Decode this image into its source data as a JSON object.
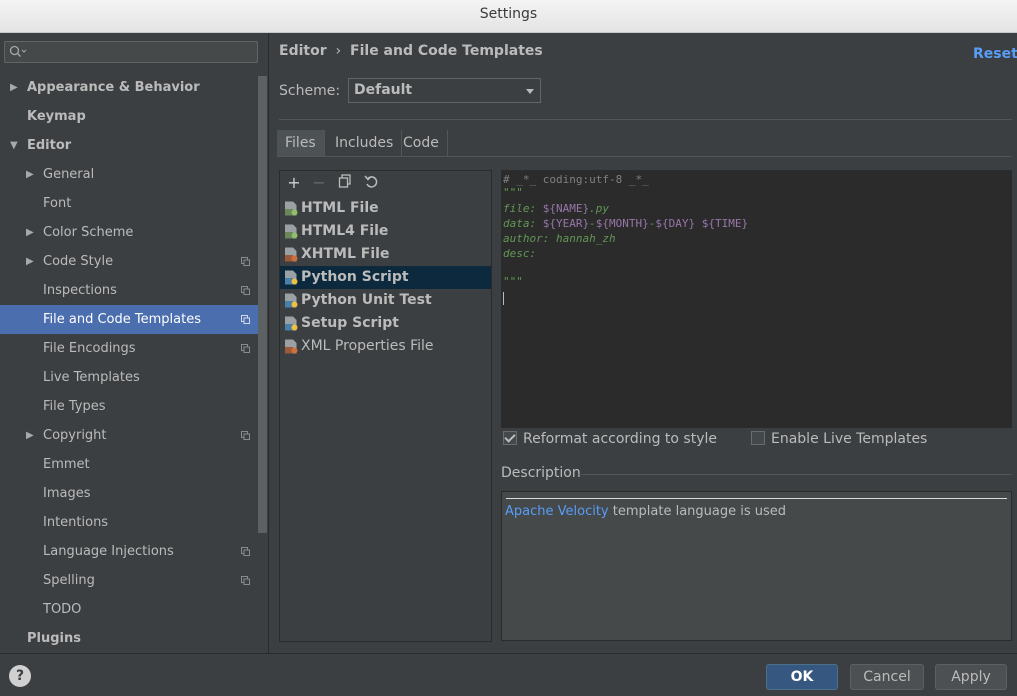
{
  "window": {
    "title": "Settings"
  },
  "sidebar": {
    "search_placeholder": "",
    "items": [
      {
        "label": "Appearance & Behavior",
        "level": 0,
        "arrow": "collapsed",
        "bold": true,
        "project": false,
        "selected": false
      },
      {
        "label": "Keymap",
        "level": 0,
        "arrow": "none",
        "bold": true,
        "project": false,
        "selected": false
      },
      {
        "label": "Editor",
        "level": 0,
        "arrow": "expanded",
        "bold": true,
        "project": false,
        "selected": false
      },
      {
        "label": "General",
        "level": 1,
        "arrow": "collapsed",
        "bold": false,
        "project": false,
        "selected": false
      },
      {
        "label": "Font",
        "level": 1,
        "arrow": "none",
        "bold": false,
        "project": false,
        "selected": false
      },
      {
        "label": "Color Scheme",
        "level": 1,
        "arrow": "collapsed",
        "bold": false,
        "project": false,
        "selected": false
      },
      {
        "label": "Code Style",
        "level": 1,
        "arrow": "collapsed",
        "bold": false,
        "project": true,
        "selected": false
      },
      {
        "label": "Inspections",
        "level": 1,
        "arrow": "none",
        "bold": false,
        "project": true,
        "selected": false
      },
      {
        "label": "File and Code Templates",
        "level": 1,
        "arrow": "none",
        "bold": false,
        "project": true,
        "selected": true
      },
      {
        "label": "File Encodings",
        "level": 1,
        "arrow": "none",
        "bold": false,
        "project": true,
        "selected": false
      },
      {
        "label": "Live Templates",
        "level": 1,
        "arrow": "none",
        "bold": false,
        "project": false,
        "selected": false
      },
      {
        "label": "File Types",
        "level": 1,
        "arrow": "none",
        "bold": false,
        "project": false,
        "selected": false
      },
      {
        "label": "Copyright",
        "level": 1,
        "arrow": "collapsed",
        "bold": false,
        "project": true,
        "selected": false
      },
      {
        "label": "Emmet",
        "level": 1,
        "arrow": "none",
        "bold": false,
        "project": false,
        "selected": false
      },
      {
        "label": "Images",
        "level": 1,
        "arrow": "none",
        "bold": false,
        "project": false,
        "selected": false
      },
      {
        "label": "Intentions",
        "level": 1,
        "arrow": "none",
        "bold": false,
        "project": false,
        "selected": false
      },
      {
        "label": "Language Injections",
        "level": 1,
        "arrow": "none",
        "bold": false,
        "project": true,
        "selected": false
      },
      {
        "label": "Spelling",
        "level": 1,
        "arrow": "none",
        "bold": false,
        "project": true,
        "selected": false
      },
      {
        "label": "TODO",
        "level": 1,
        "arrow": "none",
        "bold": false,
        "project": false,
        "selected": false
      },
      {
        "label": "Plugins",
        "level": 0,
        "arrow": "none",
        "bold": true,
        "project": false,
        "selected": false
      }
    ]
  },
  "breadcrumb": {
    "parent": "Editor",
    "separator": "›",
    "current": "File and Code Templates"
  },
  "reset_label": "Reset",
  "scheme": {
    "label": "Scheme:",
    "value": "Default"
  },
  "tabs": [
    {
      "label": "Files",
      "active": true
    },
    {
      "label": "Includes",
      "active": false
    },
    {
      "label": "Code",
      "active": false
    }
  ],
  "toolbar": {
    "add": "+",
    "remove": "−"
  },
  "templates": [
    {
      "label": "HTML File",
      "icon": "html-file-icon",
      "bold": true,
      "selected": false
    },
    {
      "label": "HTML4 File",
      "icon": "html-file-icon",
      "bold": true,
      "selected": false
    },
    {
      "label": "XHTML File",
      "icon": "xhtml-file-icon",
      "bold": true,
      "selected": false
    },
    {
      "label": "Python Script",
      "icon": "python-file-icon",
      "bold": true,
      "selected": true
    },
    {
      "label": "Python Unit Test",
      "icon": "python-file-icon",
      "bold": true,
      "selected": false
    },
    {
      "label": "Setup Script",
      "icon": "python-file-icon",
      "bold": true,
      "selected": false
    },
    {
      "label": "XML Properties File",
      "icon": "xml-file-icon",
      "bold": false,
      "selected": false
    }
  ],
  "code": {
    "line1": "# _*_ coding:utf-8 _*_",
    "line2": "\"\"\"",
    "file_key": "file: ",
    "file_var": "${NAME}",
    "file_ext": ".py",
    "data_key": "data: ",
    "data_year": "${YEAR}",
    "dash1": "-",
    "data_month": "${MONTH}",
    "dash2": "-",
    "data_day": "${DAY}",
    "space": " ",
    "data_time": "${TIME}",
    "author": "author: hannah_zh",
    "desc": "desc:",
    "line8": "\"\"\""
  },
  "options": {
    "reformat": {
      "label": "Reformat according to style",
      "checked": true
    },
    "live": {
      "label": "Enable Live Templates",
      "checked": false
    }
  },
  "description": {
    "label": "Description",
    "link": "Apache Velocity",
    "text": " template language is used"
  },
  "footer": {
    "help": "?",
    "ok": "OK",
    "cancel": "Cancel",
    "apply": "Apply"
  },
  "colors": {
    "accent": "#4b6eaf",
    "link": "#589df6",
    "background": "#3c3f41",
    "editor_bg": "#2b2b2b"
  }
}
